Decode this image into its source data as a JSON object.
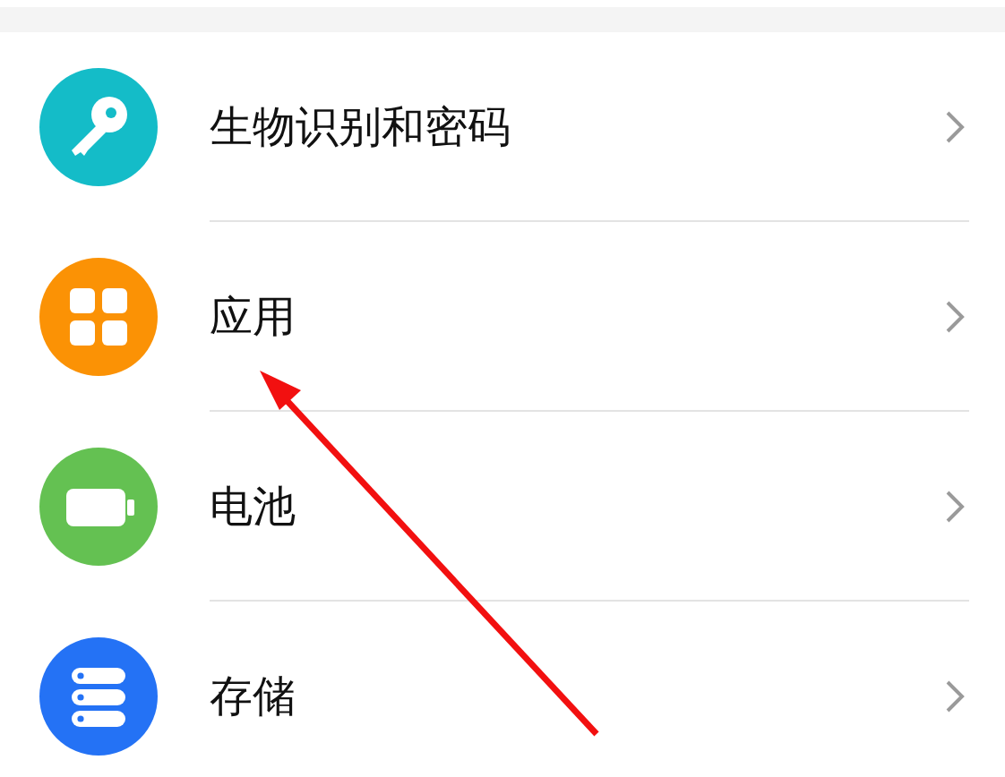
{
  "items": [
    {
      "label": "生物识别和密码",
      "kind": "key",
      "color": "#14bcc8"
    },
    {
      "label": "应用",
      "kind": "apps",
      "color": "#fb9205"
    },
    {
      "label": "电池",
      "kind": "battery",
      "color": "#64c152"
    },
    {
      "label": "存储",
      "kind": "storage",
      "color": "#2472f5"
    }
  ]
}
